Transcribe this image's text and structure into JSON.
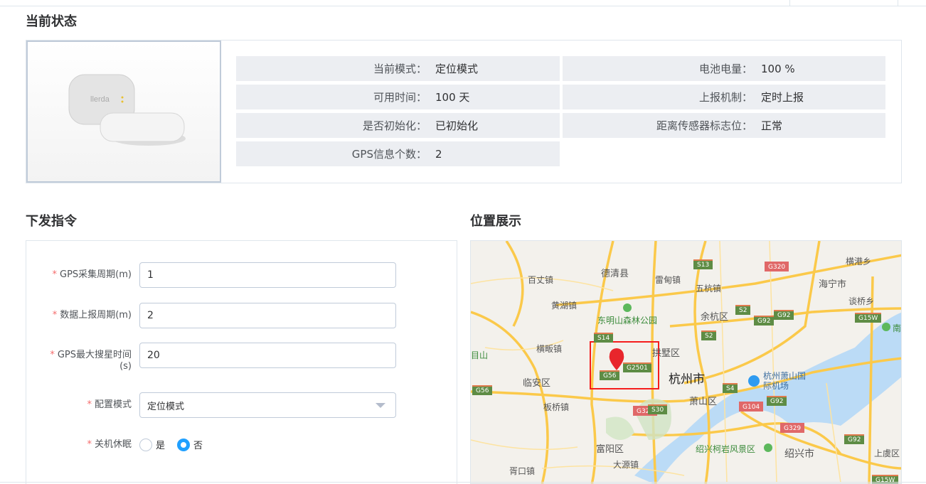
{
  "status": {
    "title": "当前状态",
    "fields": [
      {
        "label": "当前模式：",
        "value": "定位模式"
      },
      {
        "label": "电池电量：",
        "value": "100 %"
      },
      {
        "label": "可用时间：",
        "value": "100 天"
      },
      {
        "label": "上报机制：",
        "value": "定时上报"
      },
      {
        "label": "是否初始化：",
        "value": "已初始化"
      },
      {
        "label": "距离传感器标志位：",
        "value": "正常"
      },
      {
        "label": "GPS信息个数：",
        "value": "2"
      }
    ],
    "device_logo": "llerda"
  },
  "command": {
    "title": "下发指令",
    "required_mark": "*",
    "gps_period": {
      "label": "GPS采集周期(m)",
      "value": "1"
    },
    "report_period": {
      "label": "数据上报周期(m)",
      "value": "2"
    },
    "gps_search": {
      "label": "GPS最大搜星时间(s)",
      "value": "20"
    },
    "mode": {
      "label": "配置模式",
      "value": "定位模式"
    },
    "sleep": {
      "label": "关机休眠",
      "options": [
        "是",
        "否"
      ],
      "selected": "否"
    }
  },
  "location": {
    "title": "位置展示",
    "labels": [
      "德清县",
      "百丈镇",
      "雷甸镇",
      "黄湖镇",
      "东明山森林公园",
      "横畈镇",
      "拱墅区",
      "杭州市",
      "临安区",
      "板桥镇",
      "富阳区",
      "大源镇",
      "胥口镇",
      "五杭镇",
      "余杭区",
      "海宁市",
      "横港乡",
      "谈桥乡",
      "杭州萧山国际机场",
      "萧山区",
      "绍兴柯岩风景区",
      "绍兴市",
      "上虞区",
      "目山",
      "南"
    ],
    "shields": [
      "S13",
      "G320",
      "S2",
      "G92",
      "G92",
      "G15W",
      "S14",
      "S2",
      "G2501",
      "G56",
      "G56",
      "S4",
      "G320",
      "S30",
      "G104",
      "G92",
      "G329",
      "G92",
      "G15W"
    ]
  }
}
